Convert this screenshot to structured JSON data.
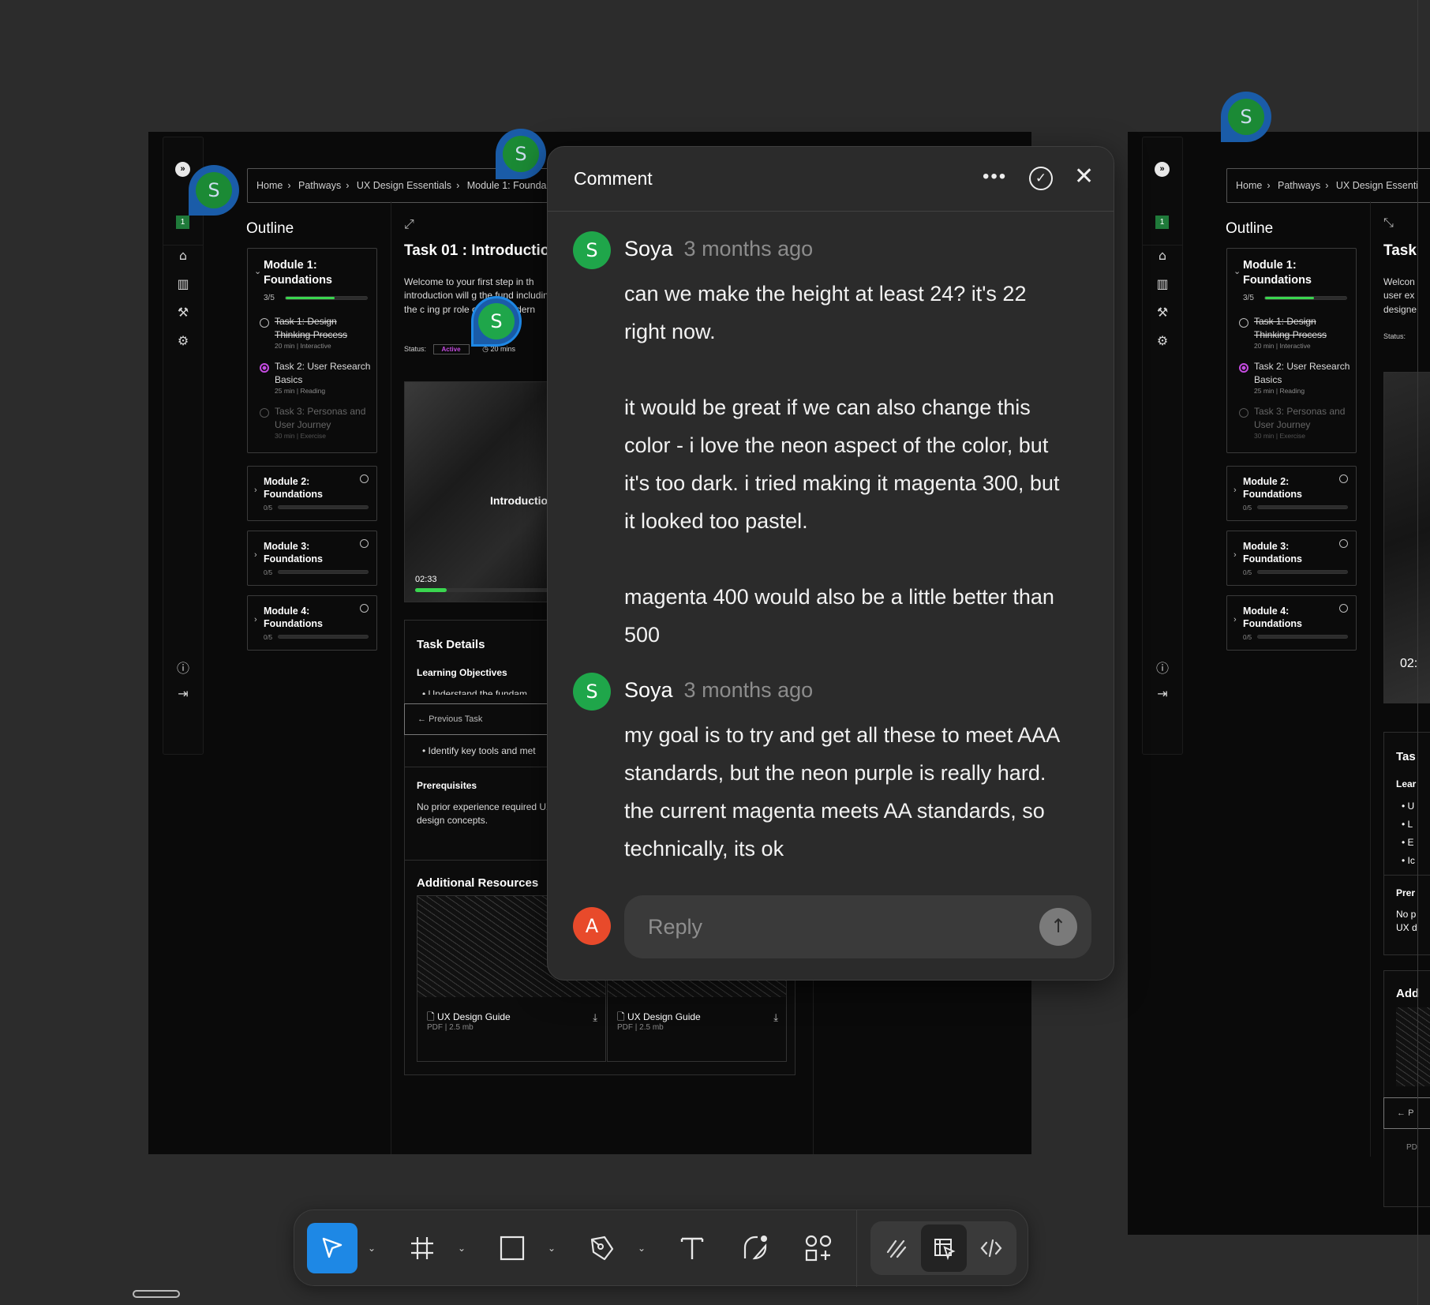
{
  "colors": {
    "canvas": "#2c2c2c",
    "accent_blue": "#1e88e5",
    "avatar_green": "#1fa64a",
    "avatar_red": "#e84a2b",
    "progress_green": "#3ad64f",
    "magenta": "#c44be0"
  },
  "frame_main": {
    "breadcrumb": [
      "Home",
      "Pathways",
      "UX Design Essentials",
      "Module 1: Founda"
    ],
    "rail_badge": "1",
    "outline_title": "Outline",
    "module1": {
      "title": "Module 1:\nFoundations",
      "progress_text": "3/5",
      "progress": 0.6,
      "tasks": [
        {
          "title": "Task 1: Design Thinking Process",
          "meta": "20 min | Interactive",
          "state": "done"
        },
        {
          "title": "Task 2: User Research Basics",
          "meta": "25 min | Reading",
          "state": "active"
        },
        {
          "title": "Task 3: Personas and User Journey",
          "meta": "30 min | Exercise",
          "state": "locked"
        }
      ]
    },
    "modules": [
      {
        "title": "Module 2:\nFoundations",
        "progress_text": "0/5"
      },
      {
        "title": "Module 3:\nFoundations",
        "progress_text": "0/5"
      },
      {
        "title": "Module 4:\nFoundations",
        "progress_text": "0/5"
      }
    ],
    "task_title": "Task 01 : Introductio",
    "task_intro": "Welcome to your first step in th introduction will g the fund including the c ing pr role of UX des dern",
    "status_label": "Status:",
    "status_value": "Active",
    "duration": "20 mins",
    "video_label": "Introductio",
    "video_time": "02:33",
    "video_progress": 0.22,
    "task_details": "Task Details",
    "learning_objectives": "Learning Objectives",
    "objective_cut": "Understand the fundam",
    "previous_task": "Previous Task",
    "objective_2": "Identify key tools and met",
    "prerequisites_title": "Prerequisites",
    "prerequisites_text": "No prior experience required UX design concepts.",
    "additional_resources": "Additional Resources",
    "resources": [
      {
        "name": "UX Design Guide",
        "meta": "PDF | 2.5 mb"
      },
      {
        "name": "UX Design Guide",
        "meta": "PDF | 2.5 mb"
      }
    ]
  },
  "frame_side": {
    "breadcrumb": [
      "Home",
      "Pathways",
      "UX Design Essenti"
    ],
    "rail_badge": "1",
    "outline_title": "Outline",
    "task_title_cut": "Task",
    "intro_cut": "Welcon user ex designe",
    "status_label": "Status:",
    "video_time_cut": "02:",
    "details_cut": "Tas",
    "learning_cut": "Lear",
    "bullets_cut": [
      "U",
      "L",
      "E",
      "Ic"
    ],
    "prereq_cut": "Prer",
    "prereq_text_cut": "No p UX d",
    "additional_cut": "Add",
    "prev_cut": "P",
    "pdf_cut": "PD"
  },
  "comment_pins": [
    "S",
    "S",
    "S",
    "S",
    "S"
  ],
  "comment": {
    "title": "Comment",
    "threads": [
      {
        "avatar": "S",
        "author": "Soya",
        "time": "3 months ago",
        "text": "can we make the height at least 24? it's 22 right now.\n\nit would be great if we can also change this color - i love the neon aspect of the color, but it's too dark. i tried making it magenta 300, but it looked too pastel.\n\nmagenta 400 would also be a little better than 500"
      },
      {
        "avatar": "S",
        "author": "Soya",
        "time": "3 months ago",
        "text": "my goal is to try and get all these to meet AAA standards, but the neon purple is really hard. the current magenta meets AA standards, so technically, its ok"
      }
    ],
    "reply_avatar": "A",
    "reply_placeholder": "Reply"
  },
  "toolbar": {
    "tools": [
      "move-tool",
      "frame-tool",
      "shape-tool",
      "pen-tool",
      "text-tool",
      "comment-tool",
      "actions-tool"
    ],
    "modes": [
      "draw-mode",
      "design-mode",
      "dev-mode"
    ],
    "active_tool": "move-tool"
  }
}
